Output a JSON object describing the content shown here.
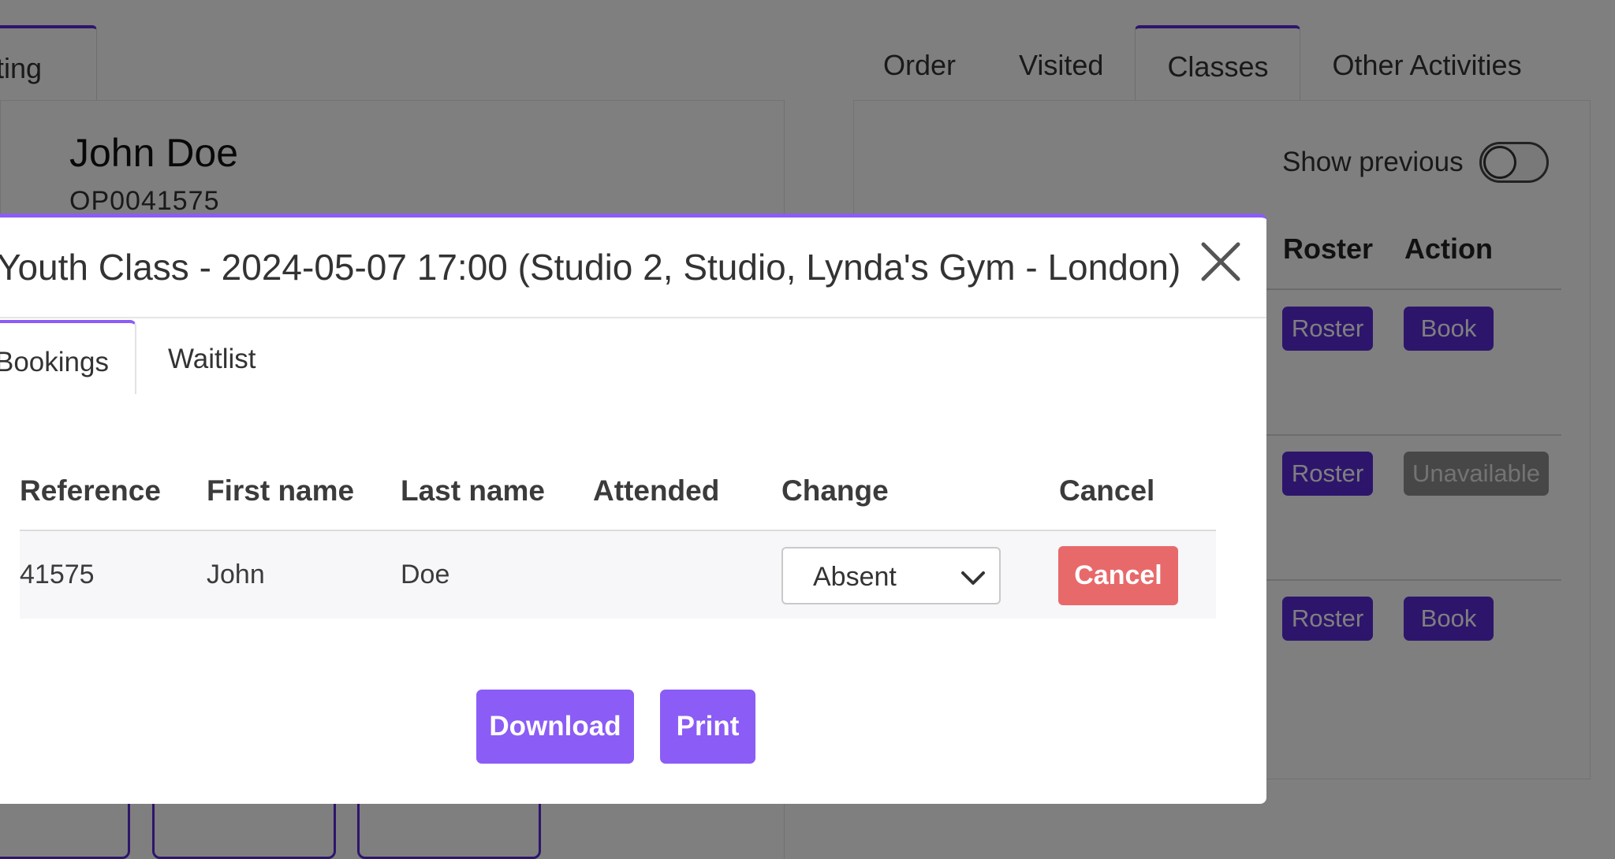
{
  "background": {
    "left_tab_label": "isting",
    "customer_name": "John Doe",
    "customer_code": "OP0041575",
    "tabs": [
      {
        "label": "Order"
      },
      {
        "label": "Visited"
      },
      {
        "label": "Classes"
      },
      {
        "label": "Other Activities"
      }
    ],
    "active_tab": "Classes",
    "show_previous_label": "Show previous",
    "show_previous_on": false,
    "table_headers": {
      "roster": "Roster",
      "action": "Action"
    },
    "rows": [
      {
        "roster": "Roster",
        "action": "Book"
      },
      {
        "roster": "Roster",
        "action": "Unavailable"
      },
      {
        "roster": "Roster",
        "action": "Book"
      }
    ]
  },
  "modal": {
    "title": "Youth Class - 2024-05-07 17:00 (Studio 2, Studio, Lynda's Gym - London)",
    "tabs": {
      "bookings": "Bookings",
      "waitlist": "Waitlist"
    },
    "active_tab": "Bookings",
    "table": {
      "headers": {
        "reference": "Reference",
        "first_name": "First name",
        "last_name": "Last name",
        "attended": "Attended",
        "change": "Change",
        "cancel": "Cancel"
      },
      "rows": [
        {
          "reference": "41575",
          "first_name": "John",
          "last_name": "Doe",
          "attended": "",
          "change_value": "Absent",
          "cancel_label": "Cancel"
        }
      ]
    },
    "download_label": "Download",
    "print_label": "Print"
  },
  "colors": {
    "accent": "#8b5cf6",
    "accent_dark": "#5b2bd8",
    "danger": "#e8696a"
  },
  "icons": {
    "close": "close-icon",
    "dropdown": "chevron-down-icon"
  }
}
